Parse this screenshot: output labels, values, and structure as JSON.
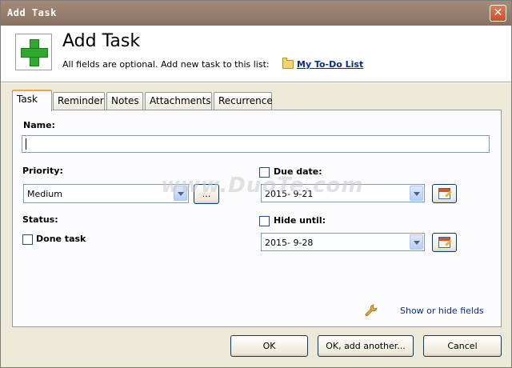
{
  "window": {
    "title": "Add Task",
    "close_label": "✕"
  },
  "header": {
    "heading": "Add Task",
    "subtitle": "All fields are optional. Add new task to this list:",
    "list_name": "My To-Do List"
  },
  "tabs": [
    {
      "label": "Task",
      "active": true
    },
    {
      "label": "Reminder",
      "active": false
    },
    {
      "label": "Notes",
      "active": false
    },
    {
      "label": "Attachments",
      "active": false
    },
    {
      "label": "Recurrence",
      "active": false
    }
  ],
  "task_tab": {
    "name_label": "Name:",
    "name_value": "",
    "priority_label": "Priority:",
    "priority_value": "Medium",
    "priority_more_label": "...",
    "status_label": "Status:",
    "done_label": "Done task",
    "done_checked": false,
    "due_date_label": "Due date:",
    "due_date_checked": false,
    "due_date_value": "2015- 9-21",
    "hide_until_label": "Hide until:",
    "hide_until_checked": false,
    "hide_until_value": "2015- 9-28",
    "show_hide_fields_label": "Show or hide fields"
  },
  "footer": {
    "ok_label": "OK",
    "ok_add_another_label": "OK, add another...",
    "cancel_label": "Cancel"
  },
  "watermark": "www.DuoTe.com",
  "icons": {
    "app": "add-task-plus-icon",
    "folder": "folder-icon",
    "calendar": "calendar-icon",
    "wrench": "wrench-icon",
    "close": "close-icon"
  },
  "colors": {
    "titlebar": "#9a8170",
    "link": "#0b2c90",
    "plus_green": "#2eaa2e",
    "active_tab_accent": "#f1a53a"
  }
}
